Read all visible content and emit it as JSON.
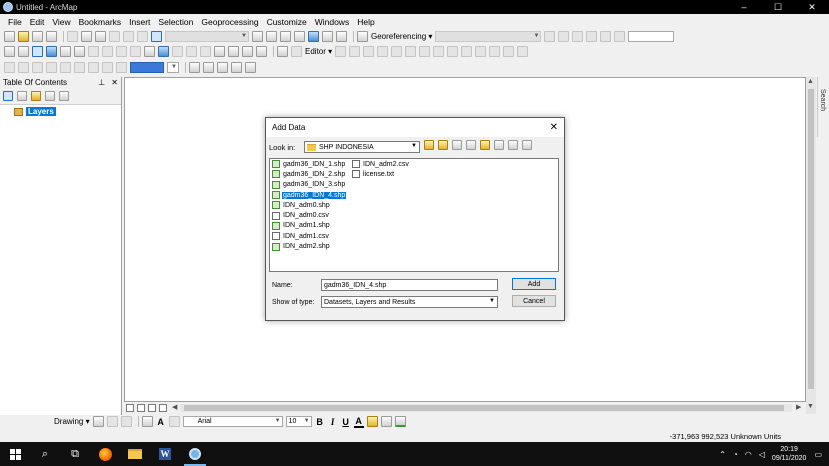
{
  "window": {
    "title": "Untitled - ArcMap",
    "controls": [
      "–",
      "☐",
      "✕"
    ]
  },
  "menu": [
    "File",
    "Edit",
    "View",
    "Bookmarks",
    "Insert",
    "Selection",
    "Geoprocessing",
    "Customize",
    "Windows",
    "Help"
  ],
  "toolbar": {
    "georeferencing_label": "Georeferencing ▾",
    "editor_label": "Editor ▾"
  },
  "toc": {
    "title": "Table Of Contents",
    "pin": "⊥",
    "close": "✕",
    "layers_label": "Layers"
  },
  "search_tab": "Search",
  "drawing": {
    "label": "Drawing ▾",
    "font": "Arial",
    "font_size": "10",
    "bold": "B",
    "italic": "I",
    "underline": "U",
    "text_color": "A"
  },
  "status": {
    "coordinates": "-371,963  992,523 Unknown Units"
  },
  "taskbar": {
    "time": "20:19",
    "date": "09/11/2020",
    "word_letter": "W"
  },
  "dialog": {
    "title": "Add Data",
    "close": "✕",
    "look_in_label": "Look in:",
    "look_in_value": "SHP INDONESIA",
    "files_col1": [
      {
        "name": "gadm36_IDN_1.shp",
        "kind": "shp",
        "selected": false
      },
      {
        "name": "gadm36_IDN_2.shp",
        "kind": "shp",
        "selected": false
      },
      {
        "name": "gadm36_IDN_3.shp",
        "kind": "shp",
        "selected": false
      },
      {
        "name": "gadm36_IDN_4.shp",
        "kind": "shp",
        "selected": true
      },
      {
        "name": "IDN_adm0.shp",
        "kind": "shp",
        "selected": false
      },
      {
        "name": "IDN_adm0.csv",
        "kind": "doc",
        "selected": false
      },
      {
        "name": "IDN_adm1.shp",
        "kind": "shp",
        "selected": false
      },
      {
        "name": "IDN_adm1.csv",
        "kind": "doc",
        "selected": false
      },
      {
        "name": "IDN_adm2.shp",
        "kind": "shp",
        "selected": false
      }
    ],
    "files_col2": [
      {
        "name": "IDN_adm2.csv",
        "kind": "doc",
        "selected": false
      },
      {
        "name": "license.txt",
        "kind": "doc",
        "selected": false
      }
    ],
    "name_label": "Name:",
    "name_value": "gadm36_IDN_4.shp",
    "type_label": "Show of type:",
    "type_value": "Datasets, Layers and Results",
    "add_label": "Add",
    "cancel_label": "Cancel"
  }
}
